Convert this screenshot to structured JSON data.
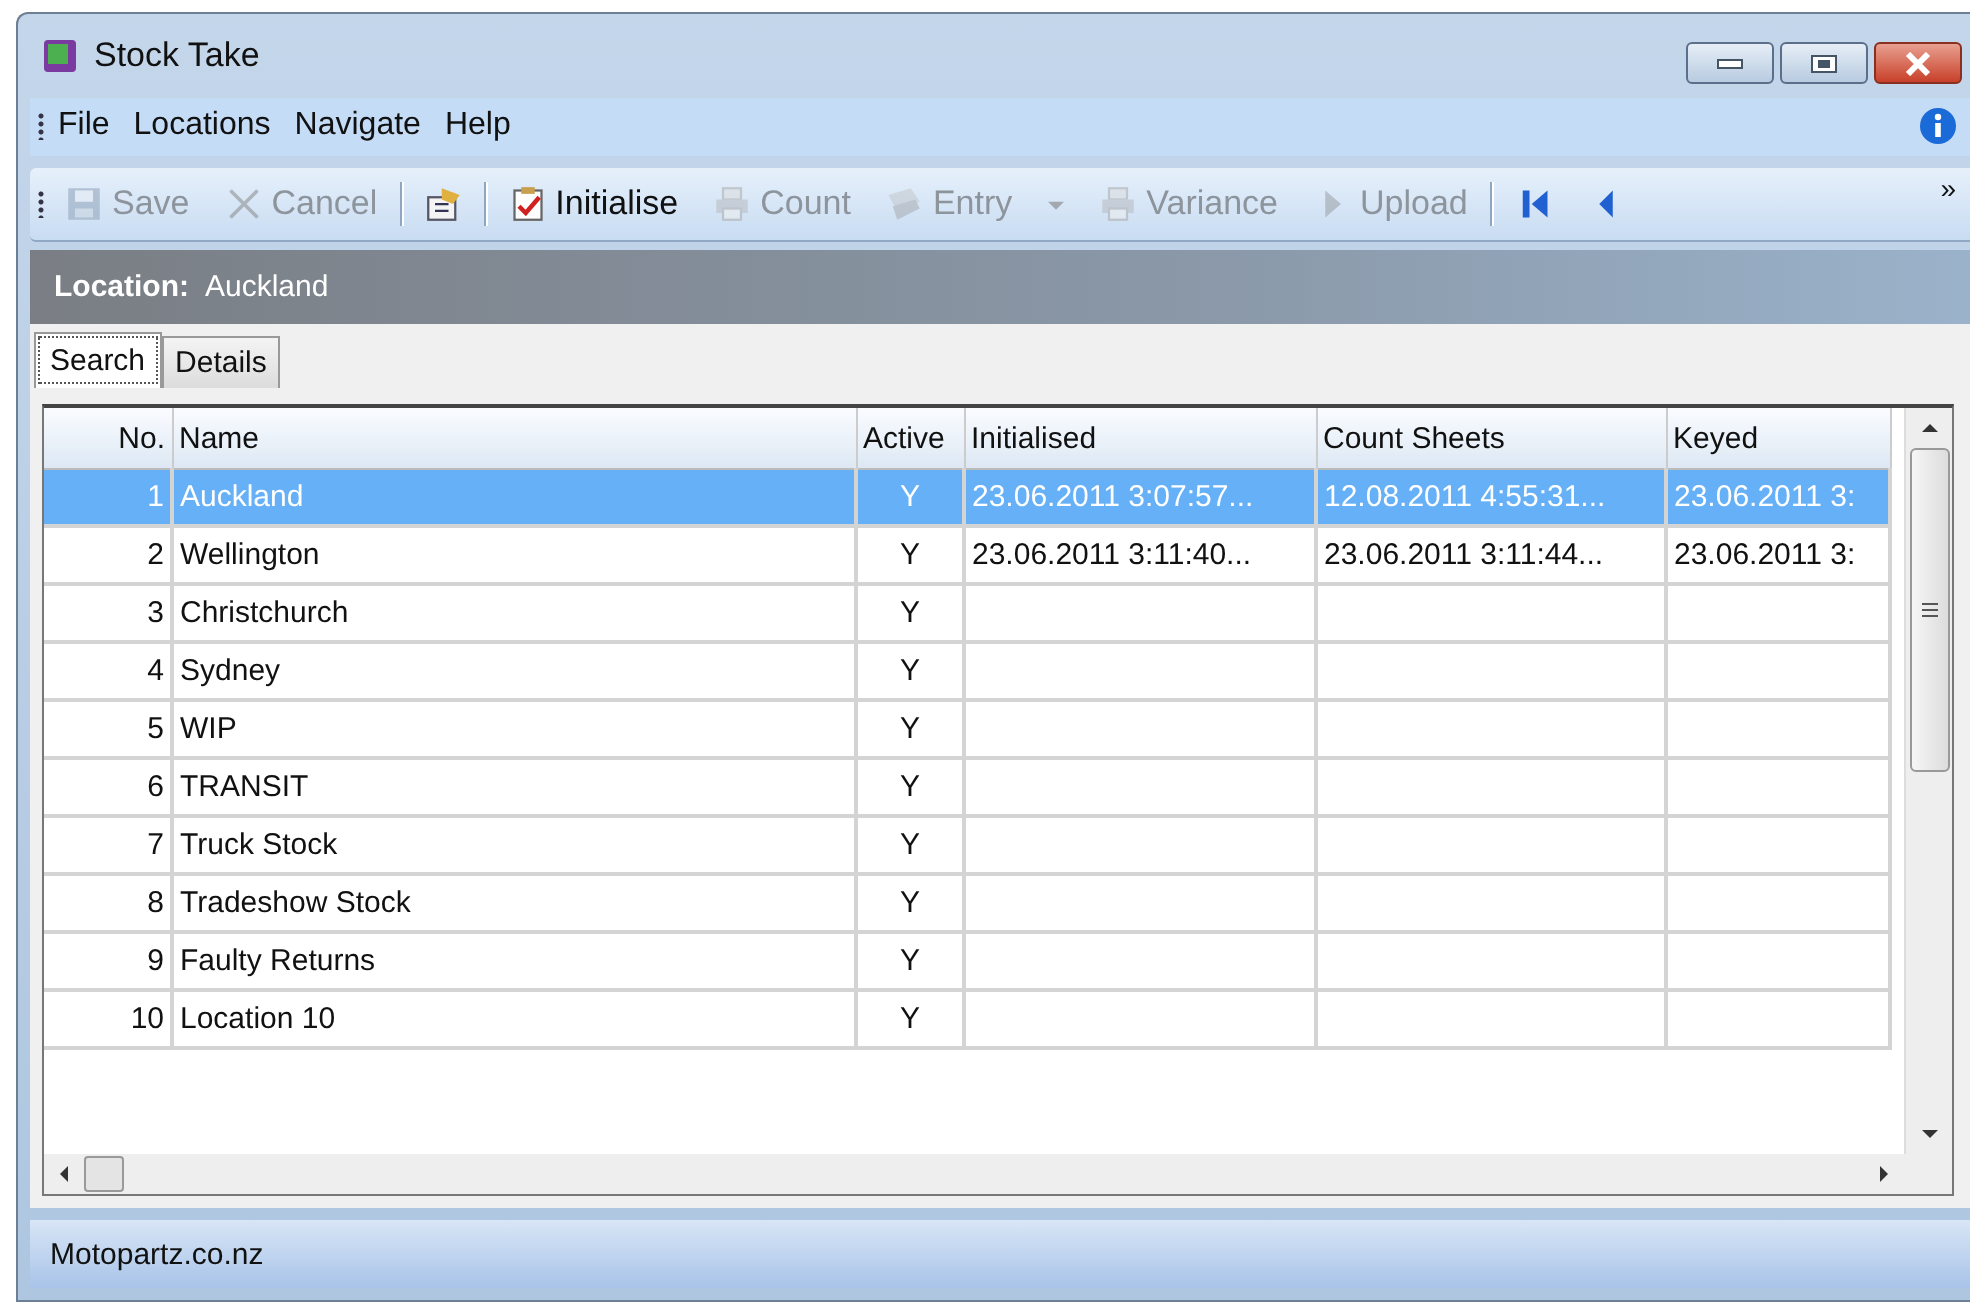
{
  "window": {
    "title": "Stock Take"
  },
  "menu": [
    "File",
    "Locations",
    "Navigate",
    "Help"
  ],
  "toolbar": [
    {
      "kind": "save",
      "label": "Save",
      "disabled": true
    },
    {
      "kind": "cancel",
      "label": "Cancel",
      "disabled": true
    },
    {
      "kind": "separator"
    },
    {
      "kind": "properties",
      "disabled": false
    },
    {
      "kind": "separator"
    },
    {
      "kind": "initialise",
      "label": "Initialise",
      "disabled": false
    },
    {
      "kind": "print",
      "label": "Count",
      "disabled": true
    },
    {
      "kind": "entry",
      "label": "Entry",
      "disabled": true
    },
    {
      "kind": "dropdown",
      "disabled": true
    },
    {
      "kind": "print",
      "label": "Variance",
      "disabled": true
    },
    {
      "kind": "upload",
      "label": "Upload",
      "disabled": true
    },
    {
      "kind": "separator"
    },
    {
      "kind": "first",
      "disabled": false
    },
    {
      "kind": "previous",
      "disabled": false
    },
    {
      "kind": "overflow",
      "label": "»",
      "disabled": false
    }
  ],
  "location_bar": {
    "label": "Location:",
    "value": "Auckland"
  },
  "tabs": [
    {
      "label": "Search",
      "selected": true
    },
    {
      "label": "Details",
      "selected": false
    }
  ],
  "table": {
    "columns": [
      "No.",
      "Name",
      "Active",
      "Initialised",
      "Count Sheets",
      "Keyed"
    ],
    "rows": [
      {
        "selected": true,
        "cells": [
          "1",
          "Auckland",
          "Y",
          "23.06.2011 3:07:57...",
          "12.08.2011 4:55:31...",
          "23.06.2011 3:"
        ]
      },
      {
        "selected": false,
        "cells": [
          "2",
          "Wellington",
          "Y",
          "23.06.2011 3:11:40...",
          "23.06.2011 3:11:44...",
          "23.06.2011 3:"
        ]
      },
      {
        "selected": false,
        "cells": [
          "3",
          "Christchurch",
          "Y",
          "",
          "",
          ""
        ]
      },
      {
        "selected": false,
        "cells": [
          "4",
          "Sydney",
          "Y",
          "",
          "",
          ""
        ]
      },
      {
        "selected": false,
        "cells": [
          "5",
          "WIP",
          "Y",
          "",
          "",
          ""
        ]
      },
      {
        "selected": false,
        "cells": [
          "6",
          "TRANSIT",
          "Y",
          "",
          "",
          ""
        ]
      },
      {
        "selected": false,
        "cells": [
          "7",
          "Truck Stock",
          "Y",
          "",
          "",
          ""
        ]
      },
      {
        "selected": false,
        "cells": [
          "8",
          "Tradeshow Stock",
          "Y",
          "",
          "",
          ""
        ]
      },
      {
        "selected": false,
        "cells": [
          "9",
          "Faulty Returns",
          "Y",
          "",
          "",
          ""
        ]
      },
      {
        "selected": false,
        "cells": [
          "10",
          "Location 10",
          "Y",
          "",
          "",
          ""
        ]
      }
    ]
  },
  "status_bar": {
    "text": "Motopartz.co.nz"
  }
}
